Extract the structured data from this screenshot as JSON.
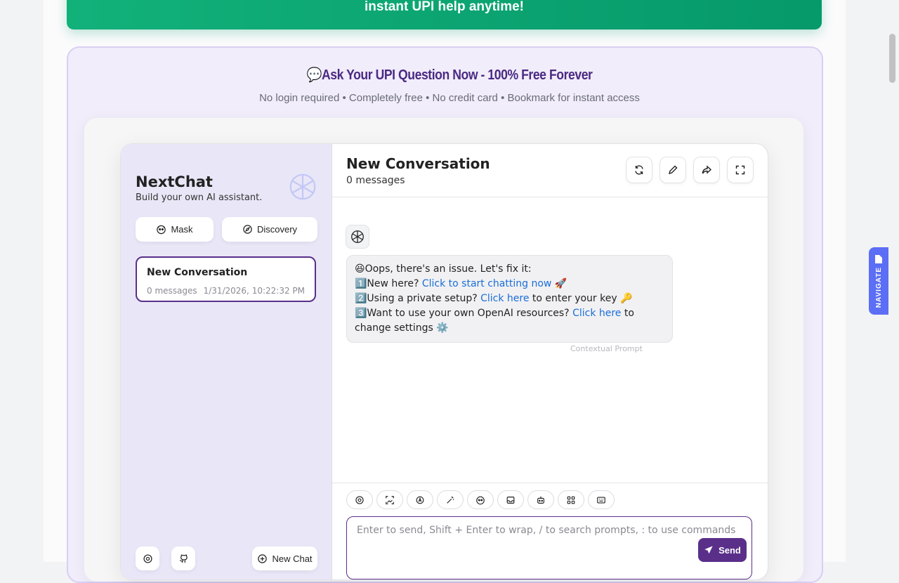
{
  "banner": {
    "text": "instant UPI help anytime!"
  },
  "ask": {
    "title": "Ask Your UPI Question Now - 100% Free Forever",
    "subtitle": "No login required • Completely free • No credit card • Bookmark for instant access"
  },
  "sidebar": {
    "brand": "NextChat",
    "tagline": "Build your own AI assistant.",
    "mask_label": "Mask",
    "discovery_label": "Discovery",
    "conversation": {
      "title": "New Conversation",
      "count": "0 messages",
      "date": "1/31/2026, 10:22:32 PM"
    },
    "new_chat_label": "New Chat"
  },
  "chat": {
    "title": "New Conversation",
    "count": "0 messages",
    "message": {
      "line1": "😆Oops, there's an issue. Let's fix it:",
      "line2_pre": "1️⃣New here? ",
      "line2_link": "Click to start chatting now",
      "line2_post": " 🚀",
      "line3_pre": "2️⃣Using a private setup? ",
      "line3_link": "Click here",
      "line3_post": " to enter your key 🔑",
      "line4_pre": "3️⃣Want to use your own OpenAI resources? ",
      "line4_link": "Click here",
      "line4_post": " to change settings ⚙️"
    },
    "meta": "Contextual Prompt",
    "input_placeholder": "Enter to send, Shift + Enter to wrap, / to search prompts, : to use commands",
    "send_label": "Send"
  },
  "navigate_label": "NAVIGATE",
  "colors": {
    "accent": "#5a2f8a",
    "banner": "#10a874",
    "link": "#1a6ed8",
    "navigate": "#5b6ef5"
  }
}
